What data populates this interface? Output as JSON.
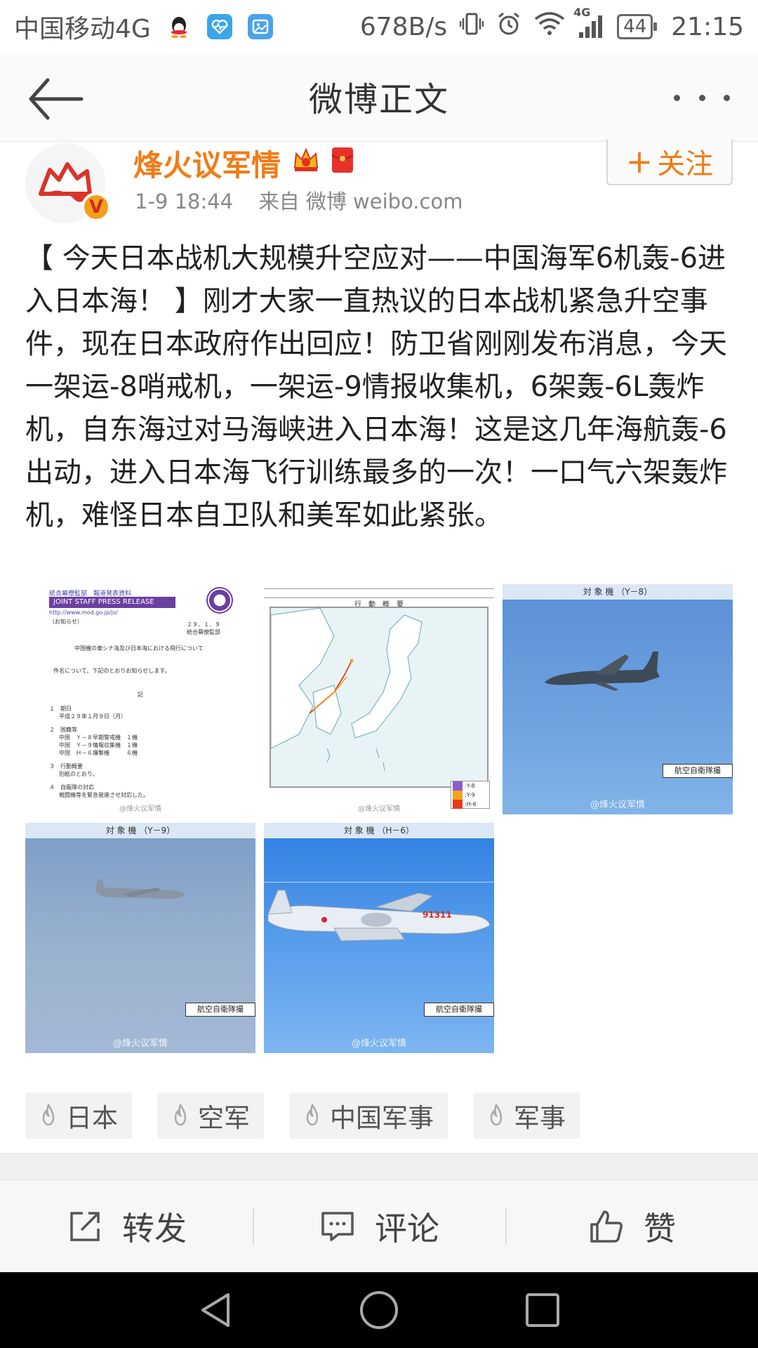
{
  "status_bar": {
    "carrier": "中国移动4G",
    "speed": "678B/s",
    "network": "4G",
    "battery": "44",
    "time": "21:15"
  },
  "nav": {
    "title": "微博正文"
  },
  "post": {
    "username": "烽火议军情",
    "avatar_badge": "V",
    "time": "1-9 18:44",
    "source": "来自 微博 weibo.com",
    "follow_label": "关注",
    "follow_plus": "+",
    "text": "【 今天日本战机大规模升空应对——中国海军6机轰-6进入日本海！ 】刚才大家一直热议的日本战机紧急升空事件，现在日本政府作出回应！防卫省刚刚发布消息，今天一架运-8哨戒机，一架运-9情报收集机，6架轰-6L轰炸机，自东海过对马海峡进入日本海！这是这几年海航轰-6出动，进入日本海飞行训练最多的一次！一口气六架轰炸机，难怪日本自卫队和美军如此紧张。"
  },
  "images": {
    "doc": {
      "header": "統合幕僚監部　報道発表資料",
      "banner": "JOINT STAFF PRESS RELEASE",
      "url": "http://www.mod.go.jp/js/",
      "notice": "（お知らせ）",
      "date": "２９．１．９",
      "dept": "統合幕僚監部",
      "subject": "中国機の東シナ海及び日本海における飛行について",
      "intro": "件名について、下記のとおりお知らせします。",
      "ki": "記",
      "item1": "１　期日",
      "item1v": "平成２９年１月９日（月）",
      "item2": "２　国籍等",
      "item2a": "中国　Ｙ－８早期警戒機　１機",
      "item2b": "中国　Ｙ－９情報収集機　１機",
      "item2c": "中国　Ｈ－６爆撃機　　　６機",
      "item3": "３　行動概要",
      "item3v": "別紙のとおり。",
      "item4": "４　自衛隊の対応",
      "item4v": "戦闘機等を緊急発進させ対応した。",
      "watermark": "@烽火议军情"
    },
    "map": {
      "title": "行　動　概　要",
      "legend": [
        ":Y-8",
        ":Y-9",
        ":H-6"
      ],
      "watermark": "@烽火议军情"
    },
    "y8": {
      "header": "対 象 機 （Y－8）",
      "label": "航空自衛隊撮",
      "watermark": "@烽火议军情"
    },
    "y9": {
      "header": "対 象 機 （Y－9）",
      "label": "航空自衛隊撮",
      "watermark": "@烽火议军情"
    },
    "h6": {
      "header": "対 象 機 （H－6）",
      "label": "航空自衛隊撮",
      "tail": "91311",
      "watermark": "@烽火议军情"
    }
  },
  "tags": [
    "日本",
    "空军",
    "中国军事",
    "军事"
  ],
  "actions": {
    "repost": "转发",
    "comment": "评论",
    "like": "赞"
  },
  "colors": {
    "accent": "#f07c16",
    "badge": "#f2a01b"
  }
}
